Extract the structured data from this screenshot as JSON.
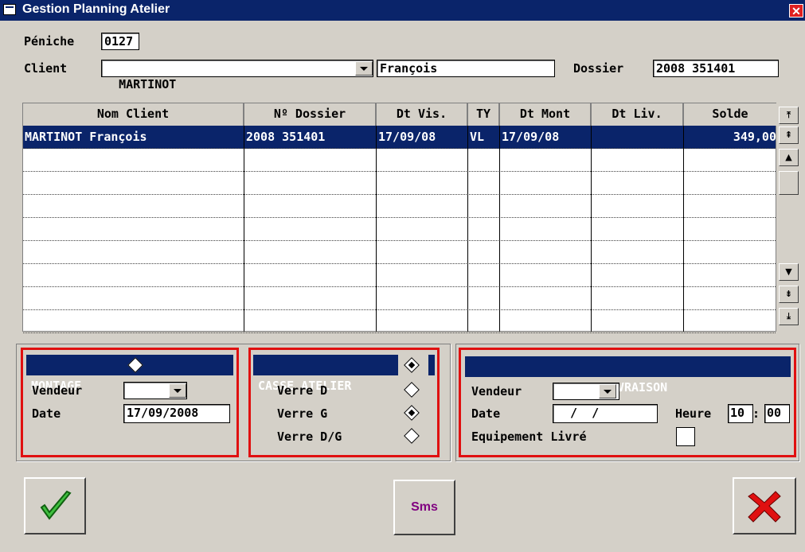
{
  "window": {
    "title": "Gestion Planning Atelier",
    "close_icon": "close-icon",
    "accent": "#0a246a"
  },
  "form": {
    "peniche_label": "Péniche",
    "peniche_value": "0127",
    "client_label": "Client",
    "client_value": "MARTINOT",
    "client_firstname": "François",
    "dossier_label": "Dossier",
    "dossier_value": "2008 351401"
  },
  "grid": {
    "columns": [
      "Nom Client",
      "Nº Dossier",
      "Dt Vis.",
      "TY",
      "Dt Mont",
      "Dt Liv.",
      "Solde"
    ],
    "rows": [
      [
        "MARTINOT François",
        "2008 351401",
        "17/09/08",
        "VL",
        "17/09/08",
        "",
        "349,00"
      ]
    ],
    "empty_rows": 8
  },
  "montage": {
    "title": "MONTAGE",
    "vendeur_label": "Vendeur",
    "vendeur_value": "",
    "date_label": "Date",
    "date_value": "17/09/2008",
    "checked": false
  },
  "casse": {
    "title": "CASSE ATELIER",
    "checked": true,
    "options": [
      {
        "label": "Verre D",
        "checked": false
      },
      {
        "label": "Verre G",
        "checked": true
      },
      {
        "label": "Verre D/G",
        "checked": false
      }
    ]
  },
  "livraison": {
    "title": "LIVRAISON",
    "vendeur_label": "Vendeur",
    "vendeur_value": "",
    "date_label": "Date",
    "date_value": "  /  /",
    "heure_label": "Heure",
    "heure_h": "10",
    "heure_m": "00",
    "equipement_label": "Equipement Livré",
    "equipement_checked": false
  },
  "buttons": {
    "sms_label": "Sms",
    "ok_icon": "checkmark-icon",
    "cancel_icon": "red-x-icon"
  }
}
